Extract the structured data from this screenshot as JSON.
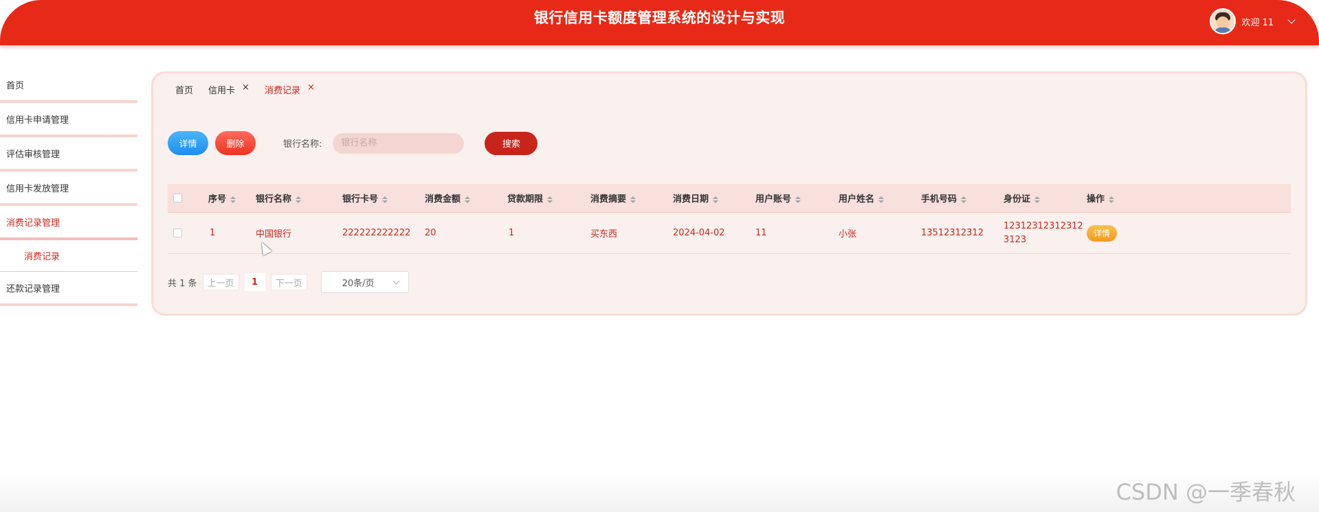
{
  "header": {
    "title": "银行信用卡额度管理系统的设计与实现",
    "welcome": "欢迎 11"
  },
  "sidebar": {
    "items": [
      {
        "label": "首页"
      },
      {
        "label": "信用卡申请管理"
      },
      {
        "label": "评估审核管理"
      },
      {
        "label": "信用卡发放管理"
      },
      {
        "label": "消费记录管理"
      },
      {
        "label": "还款记录管理"
      }
    ],
    "sub_item": "消费记录"
  },
  "tabs": [
    {
      "label": "首页"
    },
    {
      "label": "信用卡",
      "close": "×"
    },
    {
      "label": "消费记录",
      "close": "×"
    }
  ],
  "toolbar": {
    "detail_label": "详情",
    "delete_label": "删除",
    "search_label": "银行名称:",
    "search_placeholder": "银行名称",
    "search_button": "搜索"
  },
  "table": {
    "headers": [
      "序号",
      "银行名称",
      "银行卡号",
      "消费金额",
      "贷款期限",
      "消费摘要",
      "消费日期",
      "用户账号",
      "用户姓名",
      "手机号码",
      "身份证",
      "操作"
    ],
    "rows": [
      {
        "index": "1",
        "bank_name": "中国银行",
        "card_no": "222222222222",
        "amount": "20",
        "term": "1",
        "summary": "买东西",
        "date": "2024-04-02",
        "account": "11",
        "user_name": "小张",
        "phone": "13512312312",
        "id_card_line1": "12312312312312",
        "id_card_line2": "3123",
        "action": "详情"
      }
    ]
  },
  "pagination": {
    "total": "共 1 条",
    "prev": "上一页",
    "page": "1",
    "next": "下一页",
    "page_size": "20条/页"
  },
  "watermark": "CSDN @一季春秋",
  "colors": {
    "brand": "#e72a17",
    "accent_text": "#c8281c",
    "panel_bg": "#faf0ee"
  }
}
